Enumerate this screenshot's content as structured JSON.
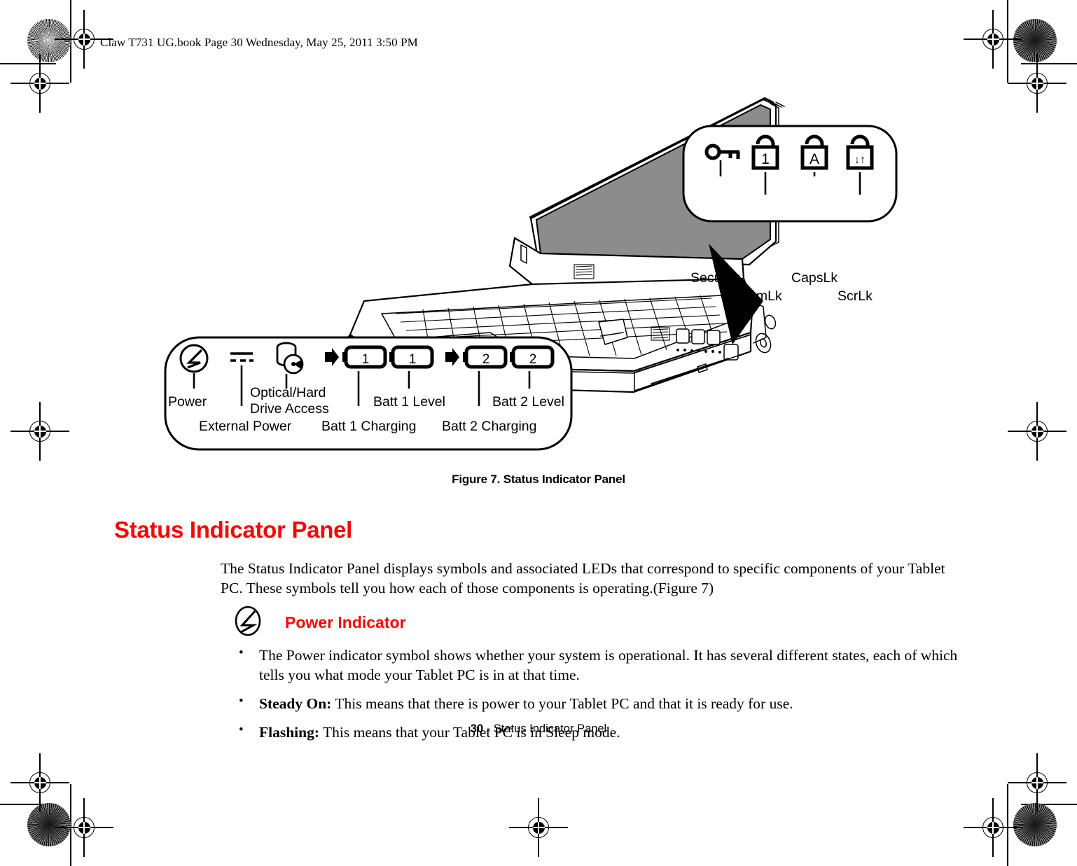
{
  "book_header": "Claw T731 UG.book  Page 30  Wednesday, May 25, 2011  3:50 PM",
  "figure": {
    "caption": "Figure 7.  Status Indicator Panel",
    "keyboard_callout": {
      "indicators": [
        {
          "icon": "key-icon",
          "label": "Security",
          "glyph": ""
        },
        {
          "icon": "lock-numlk-icon",
          "label": "NumLk",
          "glyph": "1"
        },
        {
          "icon": "lock-capslk-icon",
          "label": "CapsLk",
          "glyph": "A"
        },
        {
          "icon": "lock-scrlk-icon",
          "label": "ScrLk",
          "glyph": "↓↑"
        }
      ]
    },
    "status_callout": {
      "indicators": [
        {
          "icon": "power-icon",
          "label": "Power",
          "glyph": ""
        },
        {
          "icon": "external-power-icon",
          "label": "External Power",
          "glyph": ""
        },
        {
          "icon": "drive-access-icon",
          "label": "Optical/Hard\nDrive Access",
          "label_line1": "Optical/Hard",
          "label_line2": "Drive Access"
        },
        {
          "icon": "batt-1-charging-icon",
          "label": "Batt 1 Charging",
          "glyph": "1"
        },
        {
          "icon": "batt-1-level-icon",
          "label": "Batt 1 Level",
          "glyph": "1"
        },
        {
          "icon": "batt-2-charging-icon",
          "label": "Batt 2 Charging",
          "glyph": "2"
        },
        {
          "icon": "batt-2-level-icon",
          "label": "Batt 2 Level",
          "glyph": "2"
        }
      ]
    }
  },
  "section": {
    "title": "Status Indicator Panel",
    "intro": "The Status Indicator Panel displays symbols and associated LEDs that correspond to specific components of your Tablet PC. These symbols tell you how each of those components is operating.(Figure 7)",
    "power_indicator_heading": "Power Indicator",
    "bullets": [
      {
        "lead": "",
        "text": "The Power indicator symbol shows whether your system is operational. It has several different states, each of which tells you what mode your Tablet PC is in at that time."
      },
      {
        "lead": "Steady On:",
        "text": " This means that there is power to your Tablet PC and that it is ready for use."
      },
      {
        "lead": "Flashing:",
        "text": " This means that your Tablet PC is in Sleep mode."
      }
    ]
  },
  "footer": {
    "page_number": "30",
    "separator": " - ",
    "title": "Status Indicator Panel"
  },
  "colors": {
    "heading_red": "#ff0000",
    "ink": "#000000",
    "screen_fill": "#8c8c8c"
  }
}
